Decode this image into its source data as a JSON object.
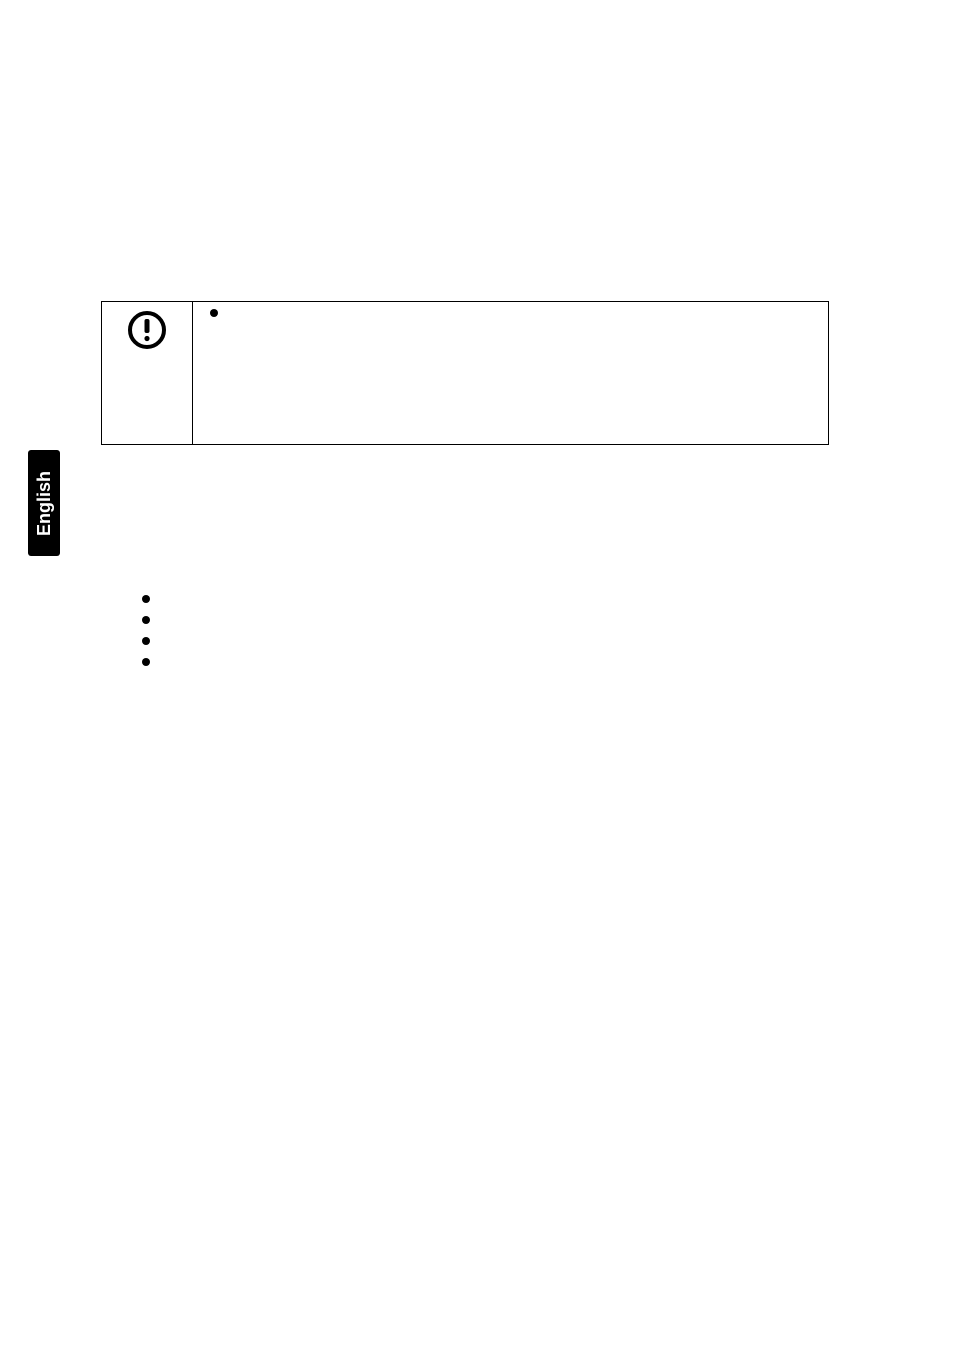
{
  "tab": {
    "label": "English"
  },
  "bullet_count": 4
}
